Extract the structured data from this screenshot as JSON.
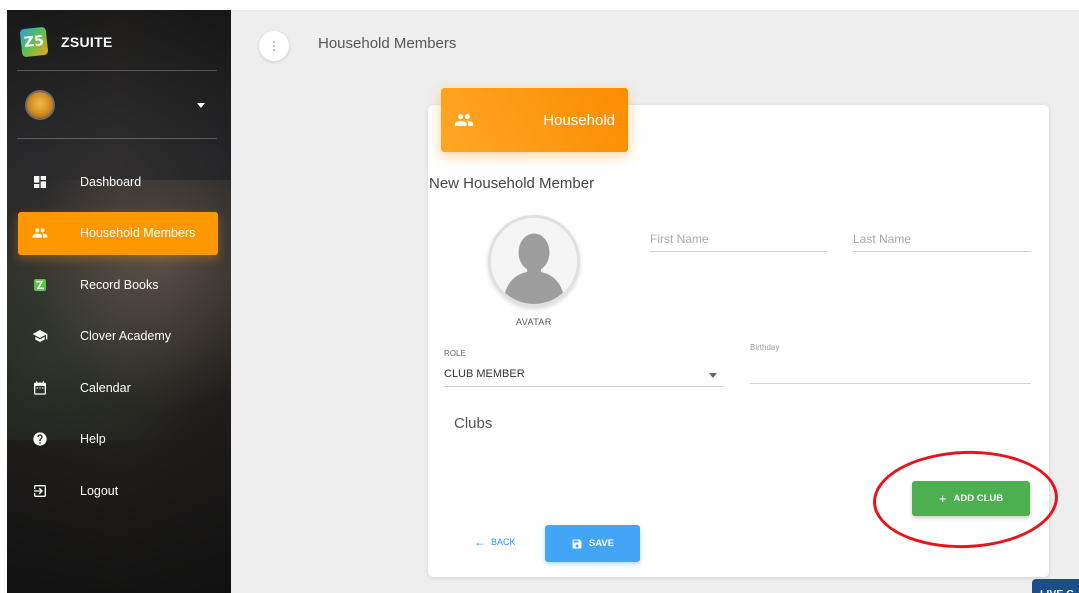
{
  "sidebar": {
    "brand": {
      "logo_text": "Z5",
      "name": "ZSUITE"
    },
    "items": [
      {
        "label": "Dashboard",
        "icon": "dashboard-icon",
        "active": false
      },
      {
        "label": "Household Members",
        "icon": "people-icon",
        "active": true
      },
      {
        "label": "Record Books",
        "icon": "zsuite-logo-icon",
        "active": false
      },
      {
        "label": "Clover Academy",
        "icon": "graduation-cap-icon",
        "active": false
      },
      {
        "label": "Calendar",
        "icon": "calendar-icon",
        "active": false
      },
      {
        "label": "Help",
        "icon": "help-icon",
        "active": false
      },
      {
        "label": "Logout",
        "icon": "logout-icon",
        "active": false
      }
    ]
  },
  "header": {
    "title": "Household Members",
    "menu_icon": "more-vertical-icon"
  },
  "card": {
    "header_title": "Household",
    "header_icon": "people-icon",
    "section_title": "New Household Member",
    "avatar_label": "AVATAR",
    "first_name": {
      "value": "",
      "placeholder": "First Name"
    },
    "last_name": {
      "value": "",
      "placeholder": "Last Name"
    },
    "role": {
      "label": "ROLE",
      "value": "CLUB MEMBER"
    },
    "birthday": {
      "label": "Birthday",
      "value": ""
    },
    "clubs_title": "Clubs",
    "add_club_label": "ADD CLUB",
    "back_label": "BACK",
    "save_label": "SAVE"
  },
  "live_chat_label": "LIVE C",
  "colors": {
    "accent": "#ff9800",
    "success": "#4caf50",
    "primary": "#42a5f5",
    "highlight": "#e8141a"
  }
}
